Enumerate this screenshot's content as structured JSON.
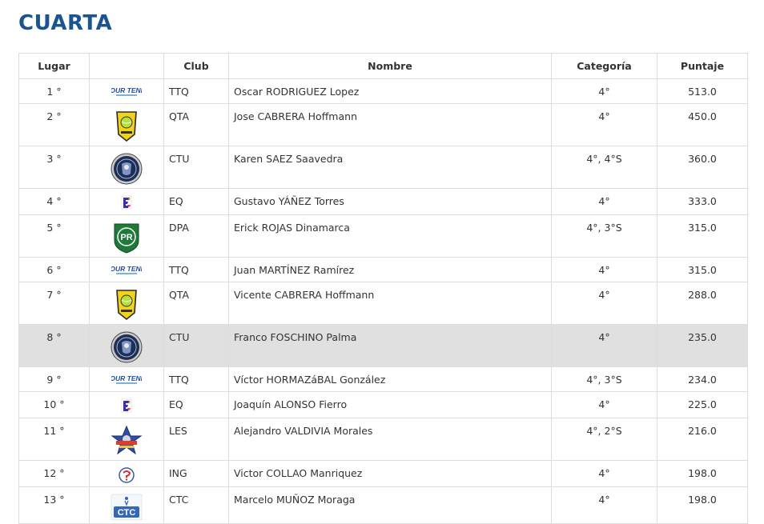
{
  "page": {
    "title": "CUARTA"
  },
  "table": {
    "headers": {
      "lugar": "Lugar",
      "club": "Club",
      "nombre": "Nombre",
      "categoria": "Categoría",
      "puntaje": "Puntaje"
    },
    "rows": [
      {
        "lugar": "1 °",
        "logo": "ttq-logo",
        "club": "TTQ",
        "nombre": "Oscar RODRIGUEZ Lopez",
        "categoria": "4°",
        "puntaje": "513.0"
      },
      {
        "lugar": "2 °",
        "logo": "qta-logo",
        "club": "QTA",
        "nombre": "Jose CABRERA Hoffmann",
        "categoria": "4°",
        "puntaje": "450.0"
      },
      {
        "lugar": "3 °",
        "logo": "ctu-logo",
        "club": "CTU",
        "nombre": "Karen SAEZ Saavedra",
        "categoria": "4°, 4°S",
        "puntaje": "360.0"
      },
      {
        "lugar": "4 °",
        "logo": "eq-logo",
        "club": "EQ",
        "nombre": "Gustavo YÁÑEZ Torres",
        "categoria": "4°",
        "puntaje": "333.0"
      },
      {
        "lugar": "5 °",
        "logo": "dpa-logo",
        "club": "DPA",
        "nombre": "Erick ROJAS Dinamarca",
        "categoria": "4°, 3°S",
        "puntaje": "315.0"
      },
      {
        "lugar": "6 °",
        "logo": "ttq-logo",
        "club": "TTQ",
        "nombre": "Juan MARTÍNEZ Ramírez",
        "categoria": "4°",
        "puntaje": "315.0"
      },
      {
        "lugar": "7 °",
        "logo": "qta-logo",
        "club": "QTA",
        "nombre": "Vicente CABRERA Hoffmann",
        "categoria": "4°",
        "puntaje": "288.0"
      },
      {
        "lugar": "8 °",
        "logo": "ctu-logo",
        "club": "CTU",
        "nombre": "Franco FOSCHINO Palma",
        "categoria": "4°",
        "puntaje": "235.0",
        "highlight": true
      },
      {
        "lugar": "9 °",
        "logo": "ttq-logo",
        "club": "TTQ",
        "nombre": "Víctor HORMAZáBAL González",
        "categoria": "4°, 3°S",
        "puntaje": "234.0"
      },
      {
        "lugar": "10 °",
        "logo": "eq-logo",
        "club": "EQ",
        "nombre": "Joaquín ALONSO Fierro",
        "categoria": "4°",
        "puntaje": "225.0"
      },
      {
        "lugar": "11 °",
        "logo": "les-logo",
        "club": "LES",
        "nombre": "Alejandro VALDIVIA Morales",
        "categoria": "4°, 2°S",
        "puntaje": "216.0"
      },
      {
        "lugar": "12 °",
        "logo": "ing-logo",
        "club": "ING",
        "nombre": "Victor COLLAO Manriquez",
        "categoria": "4°",
        "puntaje": "198.0"
      },
      {
        "lugar": "13 °",
        "logo": "ctc-logo",
        "club": "CTC",
        "nombre": "Marcelo MUÑOZ Moraga",
        "categoria": "4°",
        "puntaje": "198.0"
      }
    ]
  },
  "logos": {
    "ttq_text": "TOUR TENIS",
    "dpa_text": "PR",
    "ctc_text": "CTC"
  },
  "colors": {
    "title": "#1a5591",
    "border": "#dddddd",
    "highlight_row": "#e0e0e0"
  }
}
